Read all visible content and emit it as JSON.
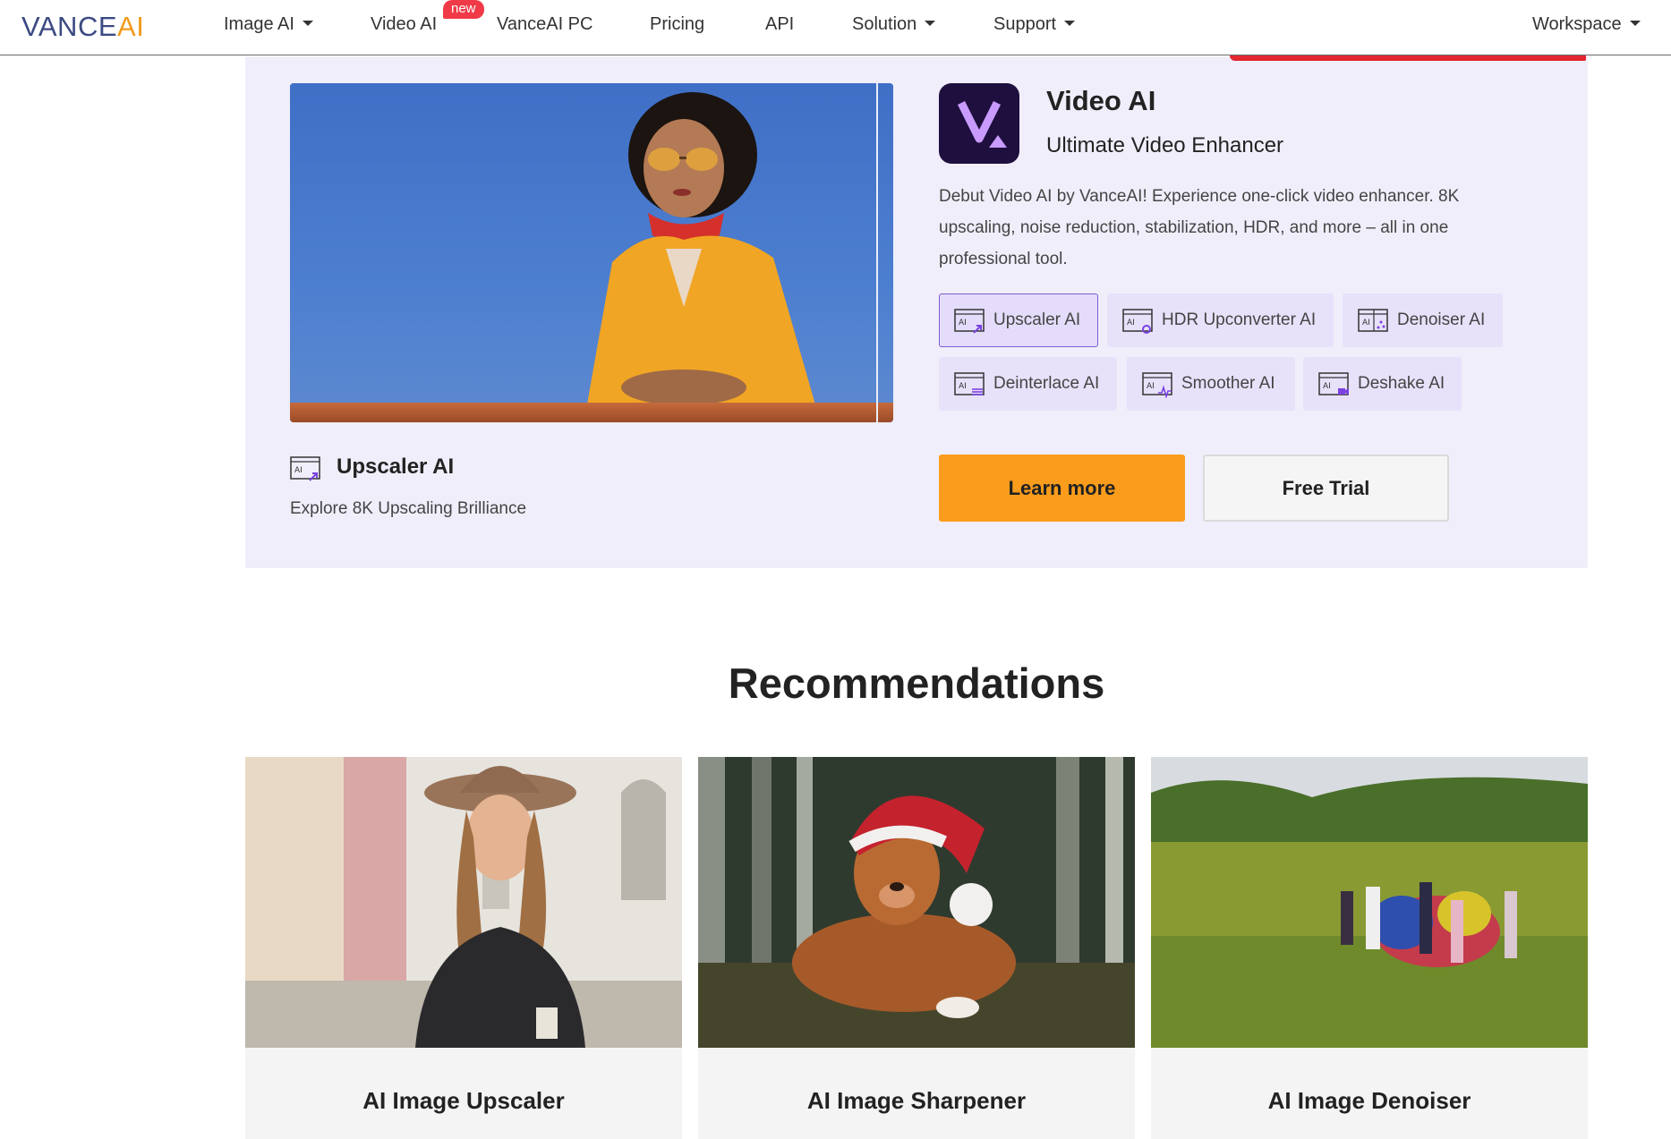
{
  "nav": {
    "logo_main": "VANCE",
    "logo_ai": "AI",
    "items": [
      {
        "label": "Image AI"
      },
      {
        "label": "Video AI"
      },
      {
        "label": "VanceAI PC"
      },
      {
        "label": "Pricing"
      },
      {
        "label": "API"
      },
      {
        "label": "Solution"
      },
      {
        "label": "Support"
      },
      {
        "label": "Workspace"
      }
    ],
    "badge": "new"
  },
  "feature": {
    "caption_title": "Upscaler AI",
    "caption_subtitle": "Explore 8K Upscaling Brilliance",
    "app_title": "Video AI",
    "app_subtitle": "Ultimate Video Enhancer",
    "description": "Debut Video AI by VanceAI! Experience one-click video enhancer. 8K upscaling, noise reduction, stabilization, HDR, and more – all in one professional tool.",
    "chips": [
      {
        "label": "Upscaler AI",
        "active": true
      },
      {
        "label": "HDR Upconverter AI"
      },
      {
        "label": "Denoiser AI"
      },
      {
        "label": "Deinterlace AI"
      },
      {
        "label": "Smoother AI"
      },
      {
        "label": "Deshake AI"
      }
    ],
    "learn_more": "Learn more",
    "free_trial": "Free Trial"
  },
  "recommendations": {
    "title": "Recommendations",
    "cards": [
      {
        "label": "AI Image Upscaler"
      },
      {
        "label": "AI Image Sharpener"
      },
      {
        "label": "AI Image Denoiser"
      }
    ]
  },
  "colors": {
    "accent_orange": "#fb9c1c",
    "panel_bg": "#f1eefb",
    "chip_bg": "#e8e1fa",
    "logo_blue": "#3b4a82",
    "badge_red": "#f03a47"
  }
}
